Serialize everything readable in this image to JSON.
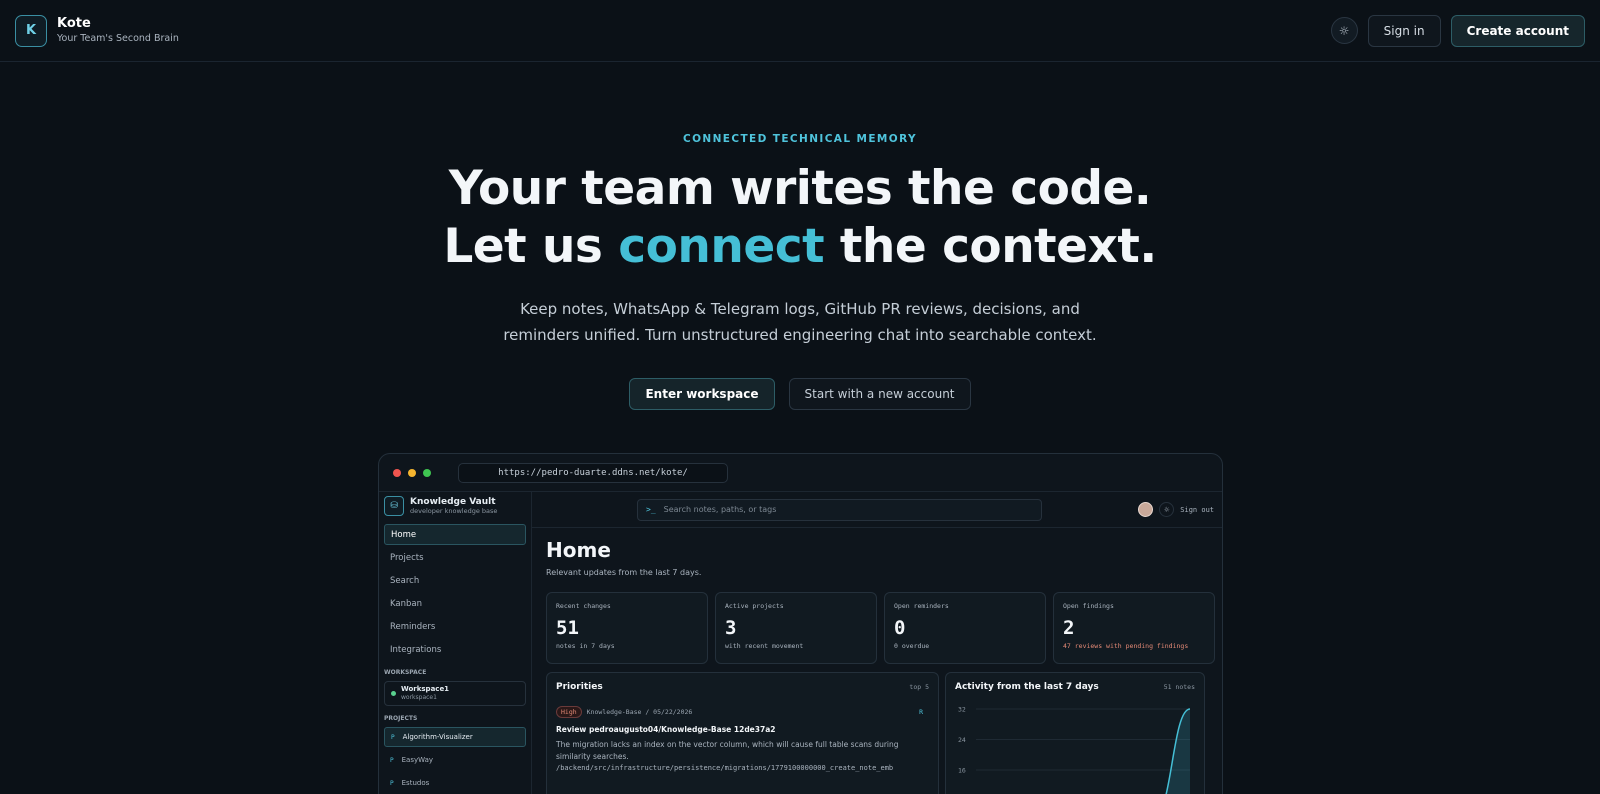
{
  "header": {
    "brand_name": "Kote",
    "brand_tagline": "Your Team's Second Brain",
    "logo_letter": "K",
    "theme_icon": "sun-icon",
    "sign_in_label": "Sign in",
    "create_account_label": "Create account"
  },
  "hero": {
    "eyebrow": "CONNECTED TECHNICAL MEMORY",
    "headline_line1": "Your team writes the code.",
    "headline_line2_before": "Let us ",
    "headline_line2_accent": "connect",
    "headline_line2_after": " the context.",
    "subtext": "Keep notes, WhatsApp & Telegram logs, GitHub PR reviews, decisions, and reminders unified. Turn unstructured engineering chat into searchable context.",
    "primary_cta": "Enter workspace",
    "secondary_cta": "Start with a new account"
  },
  "preview": {
    "url": "https://pedro-duarte.ddns.net/kote/",
    "vault_name": "Knowledge Vault",
    "vault_sub": "developer knowledge base",
    "nav": [
      {
        "label": "Home",
        "active": true
      },
      {
        "label": "Projects",
        "active": false
      },
      {
        "label": "Search",
        "active": false
      },
      {
        "label": "Kanban",
        "active": false
      },
      {
        "label": "Reminders",
        "active": false
      },
      {
        "label": "Integrations",
        "active": false
      }
    ],
    "workspace_section": "WORKSPACE",
    "workspace_name": "Workspace1",
    "workspace_sub": "workspace1",
    "projects_section": "PROJECTS",
    "projects": [
      {
        "prefix": "P",
        "label": "Algorithm-Visualizer",
        "active": true
      },
      {
        "prefix": "P",
        "label": "EasyWay",
        "active": false
      },
      {
        "prefix": "P",
        "label": "Estudos",
        "active": false
      }
    ],
    "search_prompt": ">_",
    "search_placeholder": "Search notes, paths, or tags",
    "sign_out": "Sign out",
    "page_title": "Home",
    "page_sub": "Relevant updates from the last 7 days.",
    "stats": [
      {
        "label": "Recent changes",
        "value": "51",
        "note": "notes in 7 days",
        "warn": false
      },
      {
        "label": "Active projects",
        "value": "3",
        "note": "with recent movement",
        "warn": false
      },
      {
        "label": "Open reminders",
        "value": "0",
        "note": "0 overdue",
        "warn": false
      },
      {
        "label": "Open findings",
        "value": "2",
        "note": "47 reviews with pending findings",
        "warn": true
      }
    ],
    "priorities": {
      "title": "Priorities",
      "meta": "top 5",
      "badge": "High",
      "source": "Knowledge-Base / 05/22/2026",
      "marker": "R",
      "item_title": "Review pedroaugusto04/Knowledge-Base 12de37a2",
      "item_desc": "The migration lacks an index on the vector column, which will cause full table scans during similarity searches.",
      "item_path": "/backend/src/infrastructure/persistence/migrations/1779100000000_create_note_emb"
    },
    "activity": {
      "title": "Activity from the last 7 days",
      "meta": "51 notes",
      "y_ticks": [
        "32",
        "24",
        "16"
      ],
      "accent_color": "#45bfd6"
    }
  },
  "chart_data": {
    "type": "area",
    "title": "Activity from the last 7 days",
    "ylim": [
      0,
      32
    ],
    "y_ticks": [
      32,
      24,
      16
    ],
    "series": [
      {
        "values": [
          0,
          0,
          0,
          0,
          0,
          4,
          32
        ]
      }
    ]
  }
}
